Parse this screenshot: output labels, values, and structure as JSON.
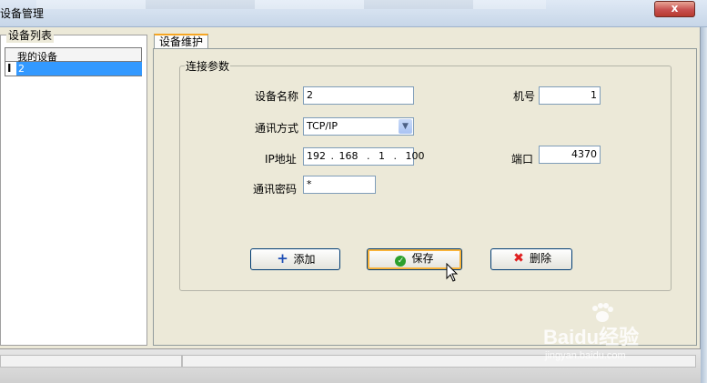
{
  "window": {
    "title": "设备管理",
    "close_label": "x"
  },
  "device_list": {
    "title": "设备列表",
    "header": "我的设备",
    "items": [
      {
        "label": "2",
        "selected": true
      }
    ]
  },
  "tabs": [
    {
      "label": "设备维护",
      "active": true
    }
  ],
  "connection": {
    "group_title": "连接参数",
    "device_name_label": "设备名称",
    "device_name_value": "2",
    "machine_no_label": "机号",
    "machine_no_value": "1",
    "comm_mode_label": "通讯方式",
    "comm_mode_value": "TCP/IP",
    "ip_label": "IP地址",
    "ip_octets": [
      "192",
      "168",
      "1",
      "100"
    ],
    "port_label": "端口",
    "port_value": "4370",
    "password_label": "通讯密码",
    "password_value": "*"
  },
  "buttons": {
    "add_label": "添加",
    "save_label": "保存",
    "delete_label": "删除"
  },
  "icons": {
    "add": "plus-icon",
    "save": "check-circle-icon",
    "delete": "x-icon"
  },
  "watermark": {
    "main": "Baidu经验",
    "sub": "jingyan.baidu.com"
  },
  "colors": {
    "selection": "#3399ff",
    "tab_accent": "#f6a623",
    "close_button": "#c75050",
    "save_icon": "#2ca02c",
    "delete_icon": "#e02020",
    "add_icon": "#1f4fb5"
  }
}
